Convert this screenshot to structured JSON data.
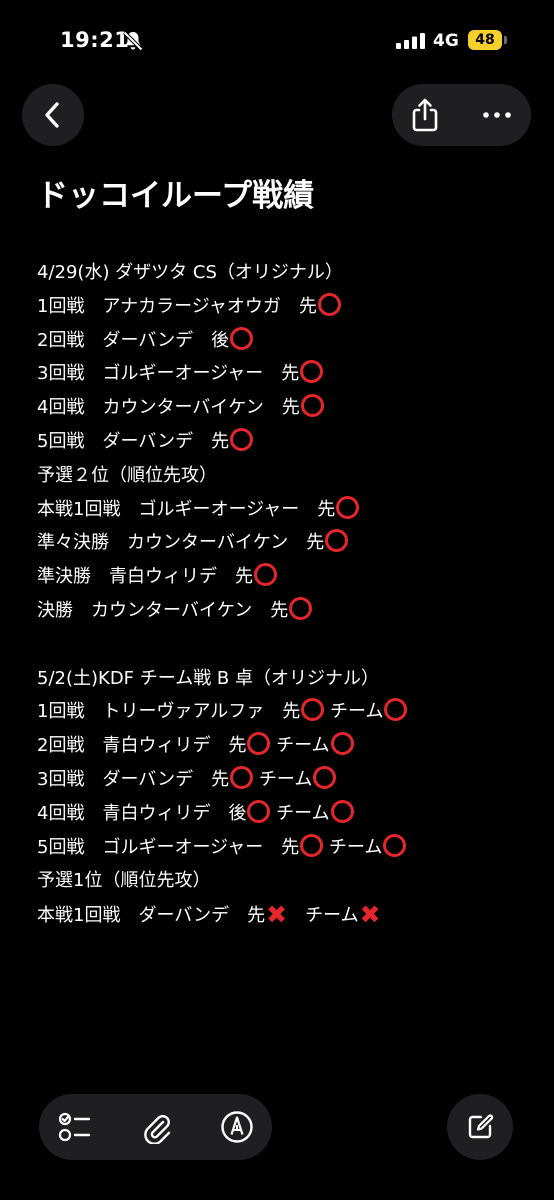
{
  "status_bar": {
    "time": "19:21",
    "network": "4G",
    "battery": "48"
  },
  "note": {
    "title": "ドッコイループ戦績",
    "lines": [
      {
        "text": "4/29(水) ダザツタ CS（オリジナル）",
        "results": []
      },
      {
        "text": "1回戦　アナカラージャオウガ　先",
        "results": [
          {
            "type": "win",
            "after": ""
          }
        ]
      },
      {
        "text": "2回戦　ダーバンデ　後",
        "results": [
          {
            "type": "win",
            "after": ""
          }
        ]
      },
      {
        "text": "3回戦　ゴルギーオージャー　先",
        "results": [
          {
            "type": "win",
            "after": ""
          }
        ]
      },
      {
        "text": "4回戦　カウンターバイケン　先",
        "results": [
          {
            "type": "win",
            "after": ""
          }
        ]
      },
      {
        "text": "5回戦　ダーバンデ　先",
        "results": [
          {
            "type": "win",
            "after": ""
          }
        ]
      },
      {
        "text": "予選２位（順位先攻）",
        "results": []
      },
      {
        "text": "本戦1回戦　ゴルギーオージャー　先",
        "results": [
          {
            "type": "win",
            "after": ""
          }
        ]
      },
      {
        "text": "準々決勝　カウンターバイケン　先",
        "results": [
          {
            "type": "win",
            "after": ""
          }
        ]
      },
      {
        "text": "準決勝　青白ウィリデ　先",
        "results": [
          {
            "type": "win",
            "after": ""
          }
        ]
      },
      {
        "text": "決勝　カウンターバイケン　先",
        "results": [
          {
            "type": "win",
            "after": ""
          }
        ]
      },
      {
        "text": "",
        "results": []
      },
      {
        "text": "5/2(土)KDF チーム戦 B 卓（オリジナル）",
        "results": []
      },
      {
        "text": "1回戦　トリーヴァアルファ　先",
        "results": [
          {
            "type": "win",
            "after": " チーム"
          },
          {
            "type": "win",
            "after": ""
          }
        ]
      },
      {
        "text": "2回戦　青白ウィリデ　先",
        "results": [
          {
            "type": "win",
            "after": " チーム"
          },
          {
            "type": "win",
            "after": ""
          }
        ]
      },
      {
        "text": "3回戦　ダーバンデ　先",
        "results": [
          {
            "type": "win",
            "after": " チーム"
          },
          {
            "type": "win",
            "after": ""
          }
        ]
      },
      {
        "text": "4回戦　青白ウィリデ　後",
        "results": [
          {
            "type": "win",
            "after": " チーム"
          },
          {
            "type": "win",
            "after": ""
          }
        ]
      },
      {
        "text": "5回戦　ゴルギーオージャー　先",
        "results": [
          {
            "type": "win",
            "after": " チーム"
          },
          {
            "type": "win",
            "after": ""
          }
        ]
      },
      {
        "text": "予選1位（順位先攻）",
        "results": []
      },
      {
        "text": "本戦1回戦　ダーバンデ　先",
        "results": [
          {
            "type": "loss",
            "after": "　チーム"
          },
          {
            "type": "loss",
            "after": ""
          }
        ]
      }
    ]
  },
  "colors": {
    "accent_red": "#e7262b",
    "button_bg": "#1f1f21",
    "battery": "#f5cf2b"
  },
  "icons": {
    "back": "chevron-left-icon",
    "share": "share-icon",
    "more": "more-icon",
    "checklist": "checklist-icon",
    "attach": "paperclip-icon",
    "markup": "pen-markup-icon",
    "compose": "compose-icon"
  }
}
